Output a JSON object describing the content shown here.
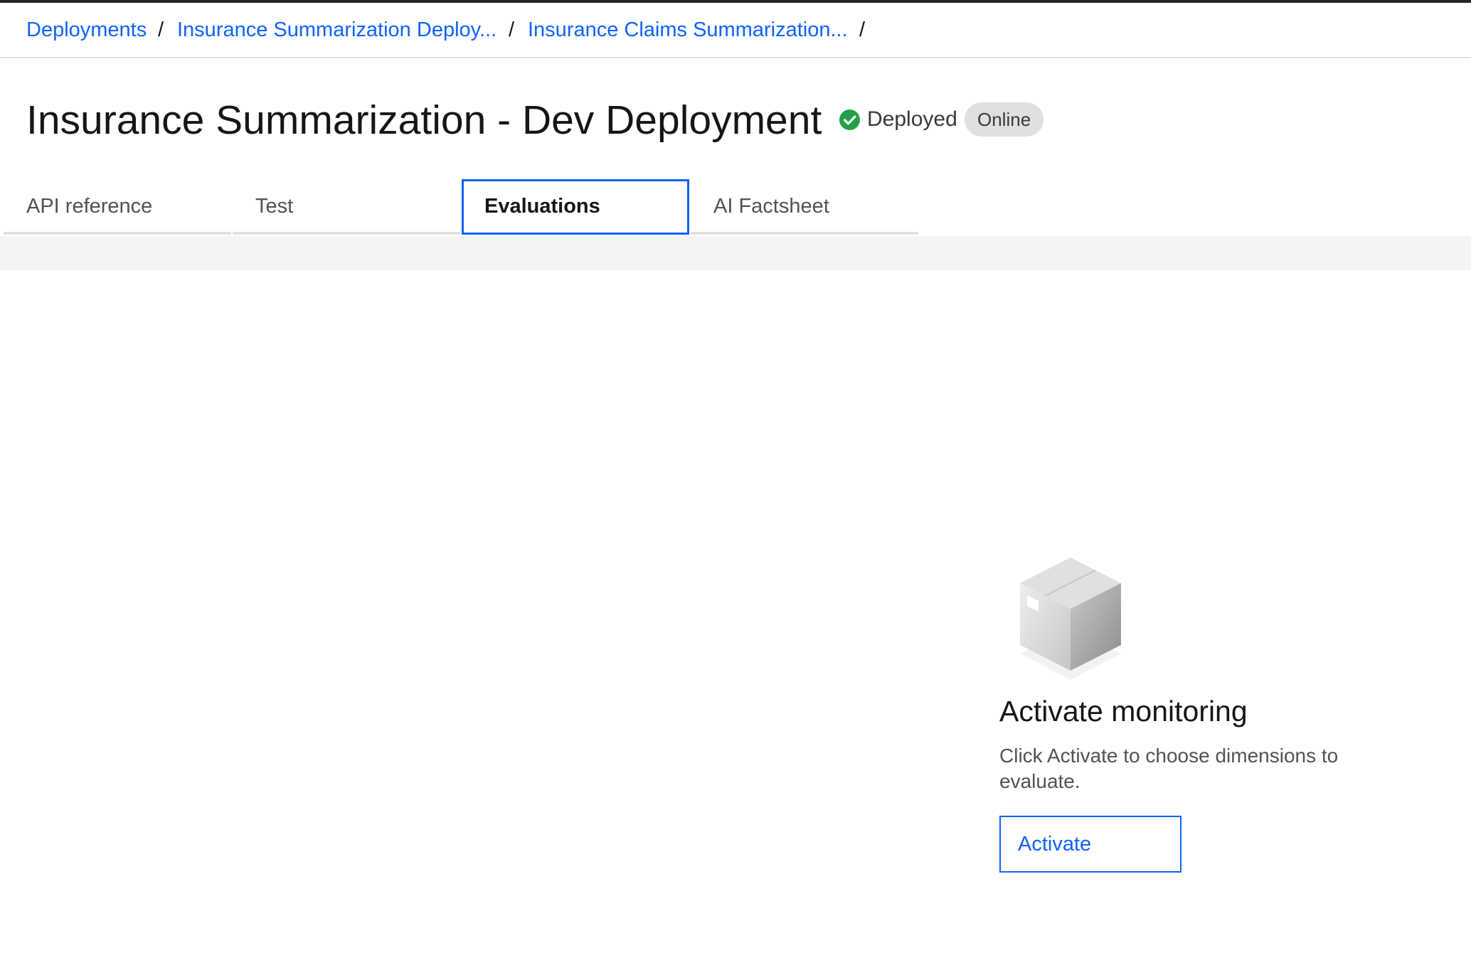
{
  "breadcrumb": {
    "items": [
      {
        "label": "Deployments"
      },
      {
        "label": "Insurance Summarization Deploy..."
      },
      {
        "label": "Insurance Claims Summarization..."
      }
    ],
    "separator": "/"
  },
  "header": {
    "title": "Insurance Summarization - Dev Deployment",
    "status": "Deployed",
    "status_color": "#24a148",
    "tag": "Online"
  },
  "tabs": [
    {
      "label": "API reference",
      "selected": false
    },
    {
      "label": "Test",
      "selected": false
    },
    {
      "label": "Evaluations",
      "selected": true
    },
    {
      "label": "AI Factsheet",
      "selected": false
    }
  ],
  "empty_state": {
    "icon": "box-icon",
    "title": "Activate monitoring",
    "description": "Click Activate to choose dimensions to evaluate.",
    "button_label": "Activate"
  },
  "colors": {
    "accent": "#0f62fe",
    "success": "#24a148"
  }
}
